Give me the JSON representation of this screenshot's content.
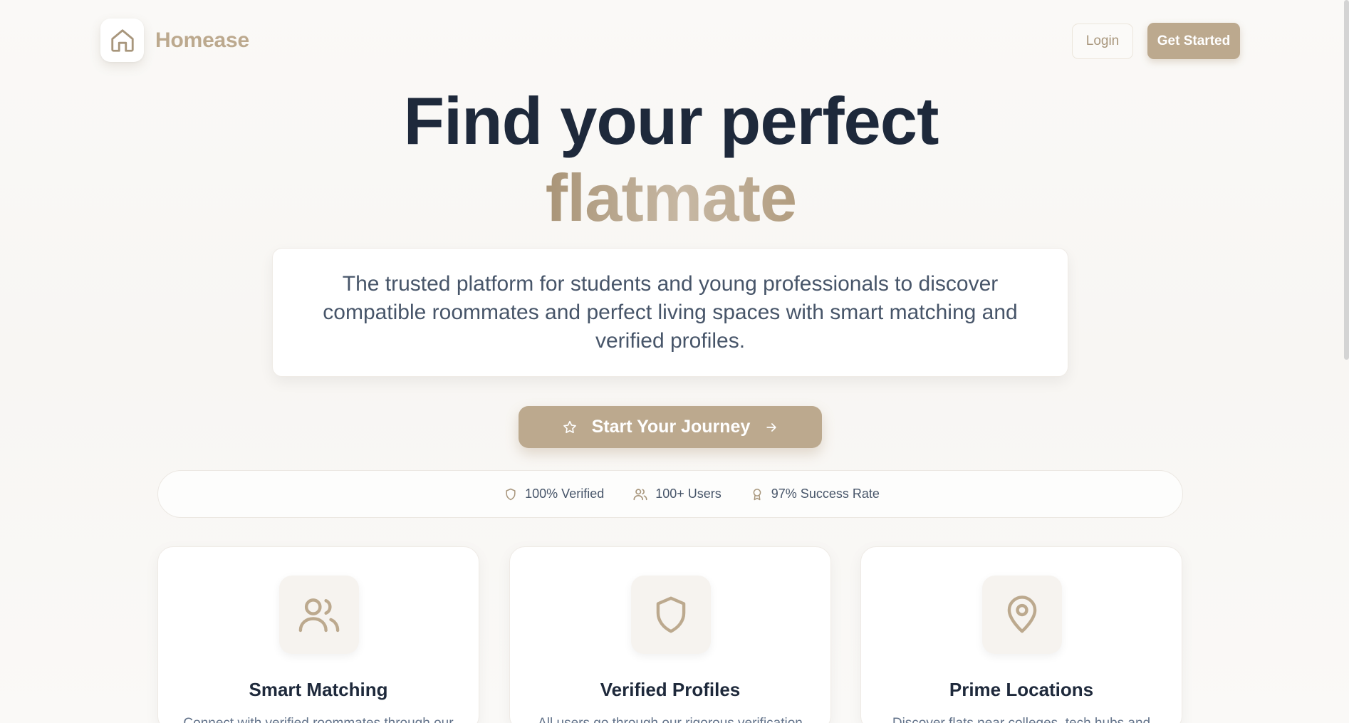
{
  "brand": {
    "name": "Homease",
    "color": "#bca98e"
  },
  "header": {
    "login_label": "Login",
    "get_started_label": "Get Started"
  },
  "hero": {
    "title_line1": "Find your perfect",
    "title_line2": "flatmate",
    "description": "The trusted platform for students and young professionals to discover compatible roommates and perfect living spaces with smart matching and verified profiles."
  },
  "cta": {
    "label": "Start Your Journey",
    "icon": "star-icon",
    "trailing_icon": "arrow-right-icon"
  },
  "stats": [
    {
      "icon": "shield-icon",
      "label": "100% Verified"
    },
    {
      "icon": "users-icon",
      "label": "100+ Users"
    },
    {
      "icon": "award-icon",
      "label": "97% Success Rate"
    }
  ],
  "features": [
    {
      "icon": "users-icon",
      "title": "Smart Matching",
      "text": "Connect with verified roommates through our"
    },
    {
      "icon": "shield-icon",
      "title": "Verified Profiles",
      "text": "All users go through our rigorous verification"
    },
    {
      "icon": "map-pin-icon",
      "title": "Prime Locations",
      "text": "Discover flats near colleges, tech hubs and"
    }
  ],
  "colors": {
    "accent": "#bca98e",
    "heading": "#1e293b",
    "text": "#475569"
  }
}
